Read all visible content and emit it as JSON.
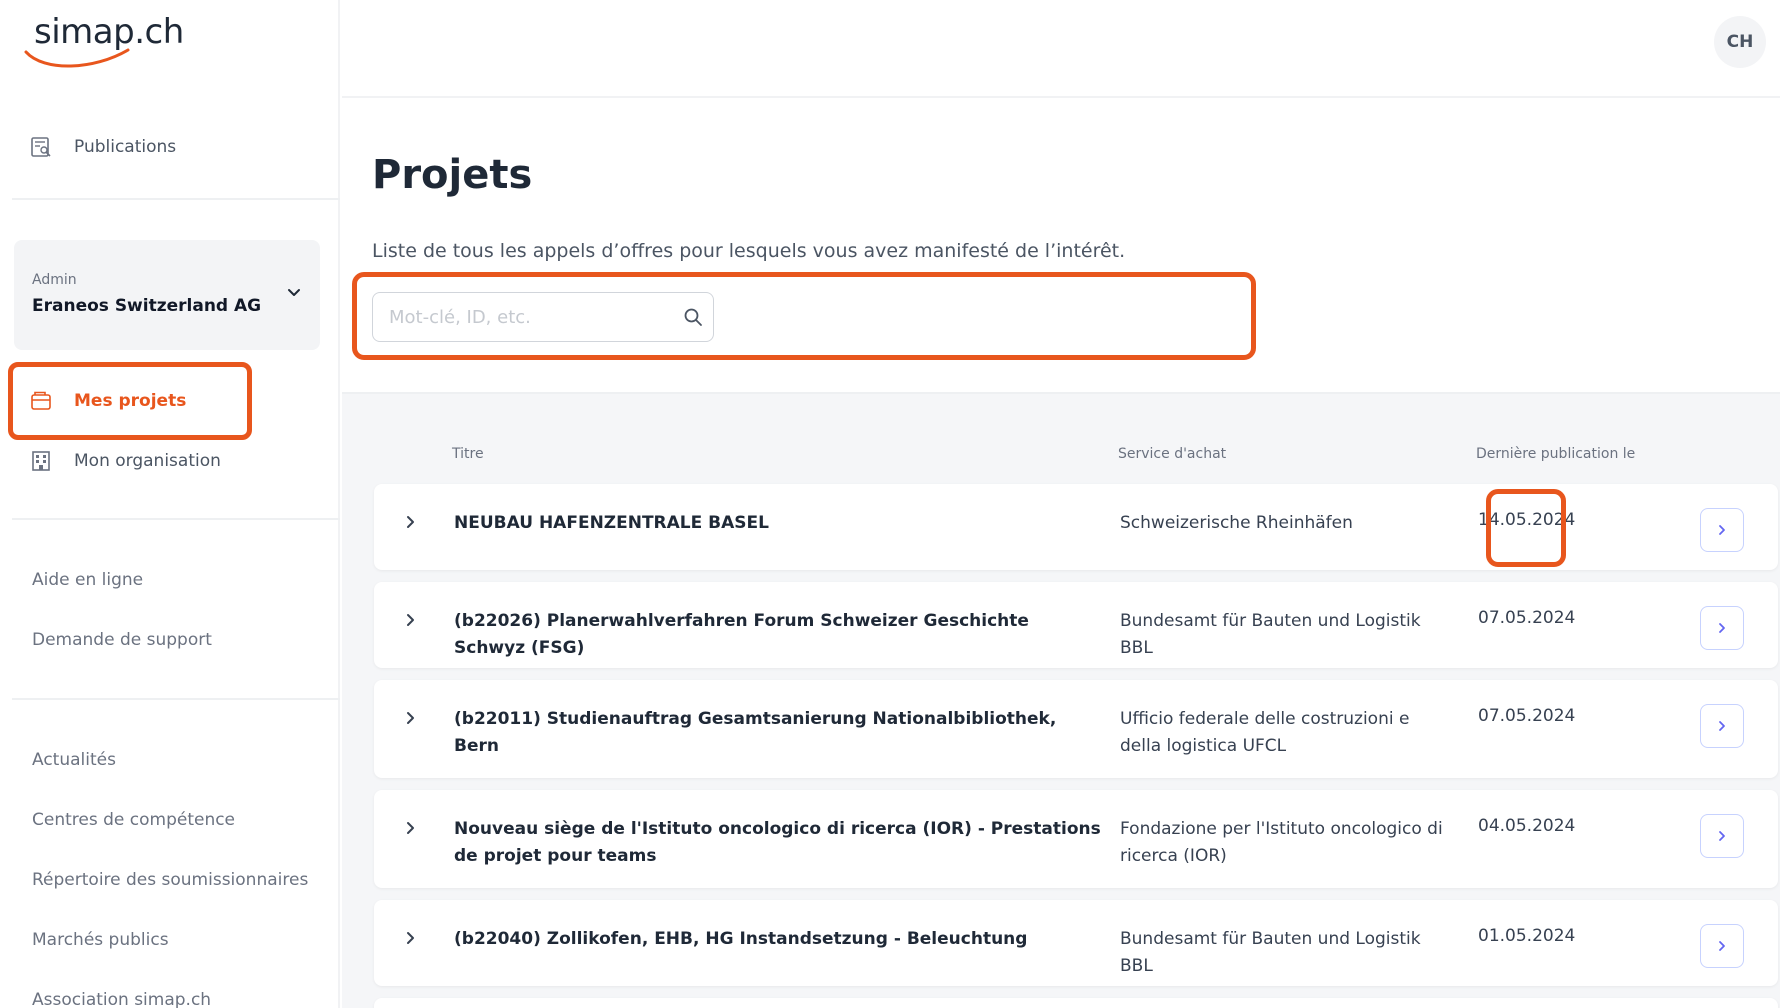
{
  "brand": {
    "name": "simap.ch",
    "accent": "#e8561d"
  },
  "sidebar": {
    "publications": "Publications",
    "org_card": {
      "role": "Admin",
      "name": "Eraneos Switzerland AG"
    },
    "mes_projets": "Mes projets",
    "mon_organisation": "Mon organisation",
    "help_links": [
      "Aide en ligne",
      "Demande de support"
    ],
    "info_links": [
      "Actualités",
      "Centres de compétence",
      "Répertoire des soumissionnaires",
      "Marchés publics",
      "Association simap.ch"
    ]
  },
  "topbar": {
    "language": "CH"
  },
  "page": {
    "title": "Projets",
    "subtitle": "Liste de tous les appels d’offres pour lesquels vous avez manifesté de l’intérêt.",
    "search_placeholder": "Mot-clé, ID, etc."
  },
  "table": {
    "columns": {
      "title": "Titre",
      "service": "Service d'achat",
      "date": "Dernière publication le"
    },
    "rows": [
      {
        "title": "NEUBAU HAFENZENTRALE BASEL",
        "service": "Schweizerische Rheinhäfen",
        "date": "14.05.2024"
      },
      {
        "title": "(b22026) Planerwahlverfahren Forum Schweizer Geschichte Schwyz (FSG)",
        "service": "Bundesamt für Bauten und Logistik BBL",
        "date": "07.05.2024"
      },
      {
        "title": "(b22011) Studienauftrag Gesamtsanierung Nationalbibliothek, Bern",
        "service": "Ufficio federale delle costruzioni e della logistica UFCL",
        "date": "07.05.2024"
      },
      {
        "title": "Nouveau siège de l'Istituto oncologico di ricerca (IOR) - Prestations de projet pour teams",
        "service": "Fondazione per l'Istituto oncologico di ricerca (IOR)",
        "date": "04.05.2024"
      },
      {
        "title": "(b22040) Zollikofen, EHB, HG Instandsetzung - Beleuchtung",
        "service": "Bundesamt für Bauten und Logistik BBL",
        "date": "01.05.2024"
      }
    ]
  }
}
